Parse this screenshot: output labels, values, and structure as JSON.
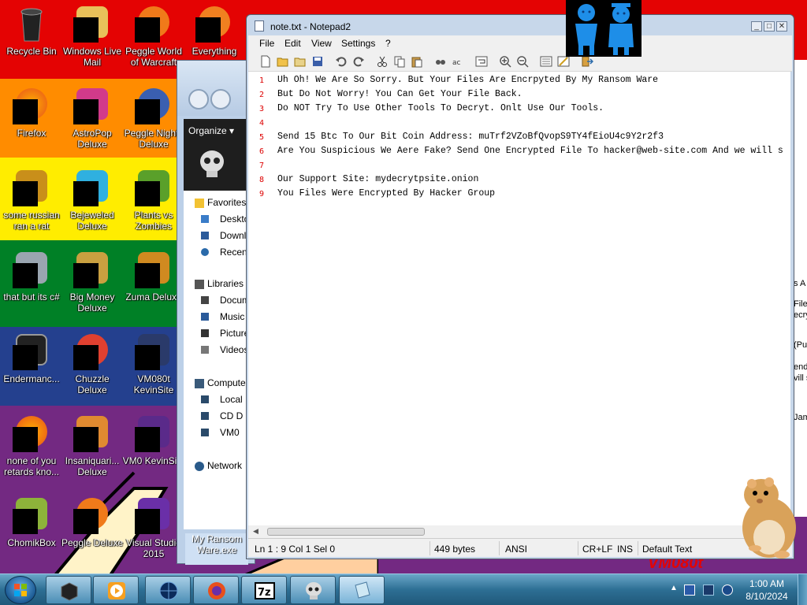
{
  "desktop": {
    "icons": [
      {
        "label": "Recycle Bin"
      },
      {
        "label": "Windows Live Mail"
      },
      {
        "label": "Peggle World of Warcraft"
      },
      {
        "label": "Everything"
      },
      {
        "label": "Firefox"
      },
      {
        "label": "AstroPop Deluxe"
      },
      {
        "label": "Peggle Nights Deluxe"
      },
      {
        "label": "some russian ran a rat"
      },
      {
        "label": "Bejeweled Deluxe"
      },
      {
        "label": "Plants vs Zombies"
      },
      {
        "label": "that but its c#"
      },
      {
        "label": "Big Money Deluxe"
      },
      {
        "label": "Zuma Deluxe"
      },
      {
        "label": "Endermanc..."
      },
      {
        "label": "Chuzzle Deluxe"
      },
      {
        "label": "VM080t KevinSite"
      },
      {
        "label": "none of you retards kno..."
      },
      {
        "label": "Insaniquari... Deluxe"
      },
      {
        "label": "VM0 KevinSi..."
      },
      {
        "label": "ChomikBox"
      },
      {
        "label": "Peggle Deluxe"
      },
      {
        "label": "Visual Studio 2015"
      }
    ],
    "wallpaper_text": "VM080t"
  },
  "explorer": {
    "organize_label": "Organize ▾",
    "nav": {
      "favorites": "Favorites",
      "desktop": "Desktop",
      "downloads": "Downloads",
      "recent": "Recent",
      "libraries": "Libraries",
      "documents": "Documents",
      "music": "Music",
      "pictures": "Pictures",
      "videos": "Videos",
      "computer": "Computer",
      "local": "Local",
      "cd": "CD D",
      "vm": "VM0",
      "network": "Network"
    },
    "exe_label": "My Ransom Ware.exe"
  },
  "bgwin": {
    "fragments": [
      "s A",
      "File",
      "ecry",
      "(Pu",
      "end",
      "vill s",
      "Jam"
    ]
  },
  "notepad": {
    "title": "note.txt - Notepad2",
    "menu": [
      "File",
      "Edit",
      "View",
      "Settings",
      "?"
    ],
    "lines": [
      "Uh Oh! We Are So Sorry. But Your Files Are Encrpyted By My Ransom Ware",
      "But Do Not Worry! You Can Get Your File Back.",
      "Do NOT Try To Use Other Tools To Decryt. Onlt Use Our Tools.",
      "",
      "Send 15 Btc To Our Bit Coin Address: muTrf2VZoBfQvopS9TY4fEioU4c9Y2r2f3",
      "Are You Suspicious We Aere Fake? Send One Encrypted File To hacker@web-site.com And we will s",
      "",
      "Our Support Site: mydecrytpsite.onion",
      "You Files Were Encrypted By Hacker Group"
    ],
    "line_numbers": [
      "1",
      "2",
      "3",
      "4",
      "5",
      "6",
      "7",
      "8",
      "9"
    ],
    "status": {
      "position": "Ln 1 : 9   Col 1   Sel 0",
      "size": "449 bytes",
      "encoding": "ANSI",
      "eol": "CR+LF",
      "mode": "INS",
      "scheme": "Default Text"
    }
  },
  "taskbar": {
    "time": "1:00 AM",
    "date": "8/10/2024"
  },
  "colors": {
    "line_number": "#dd0000",
    "taskbar": "#2d6f94",
    "rainbow": [
      "#e40303",
      "#ff8c00",
      "#ffed00",
      "#008026",
      "#24408e",
      "#732982"
    ]
  }
}
